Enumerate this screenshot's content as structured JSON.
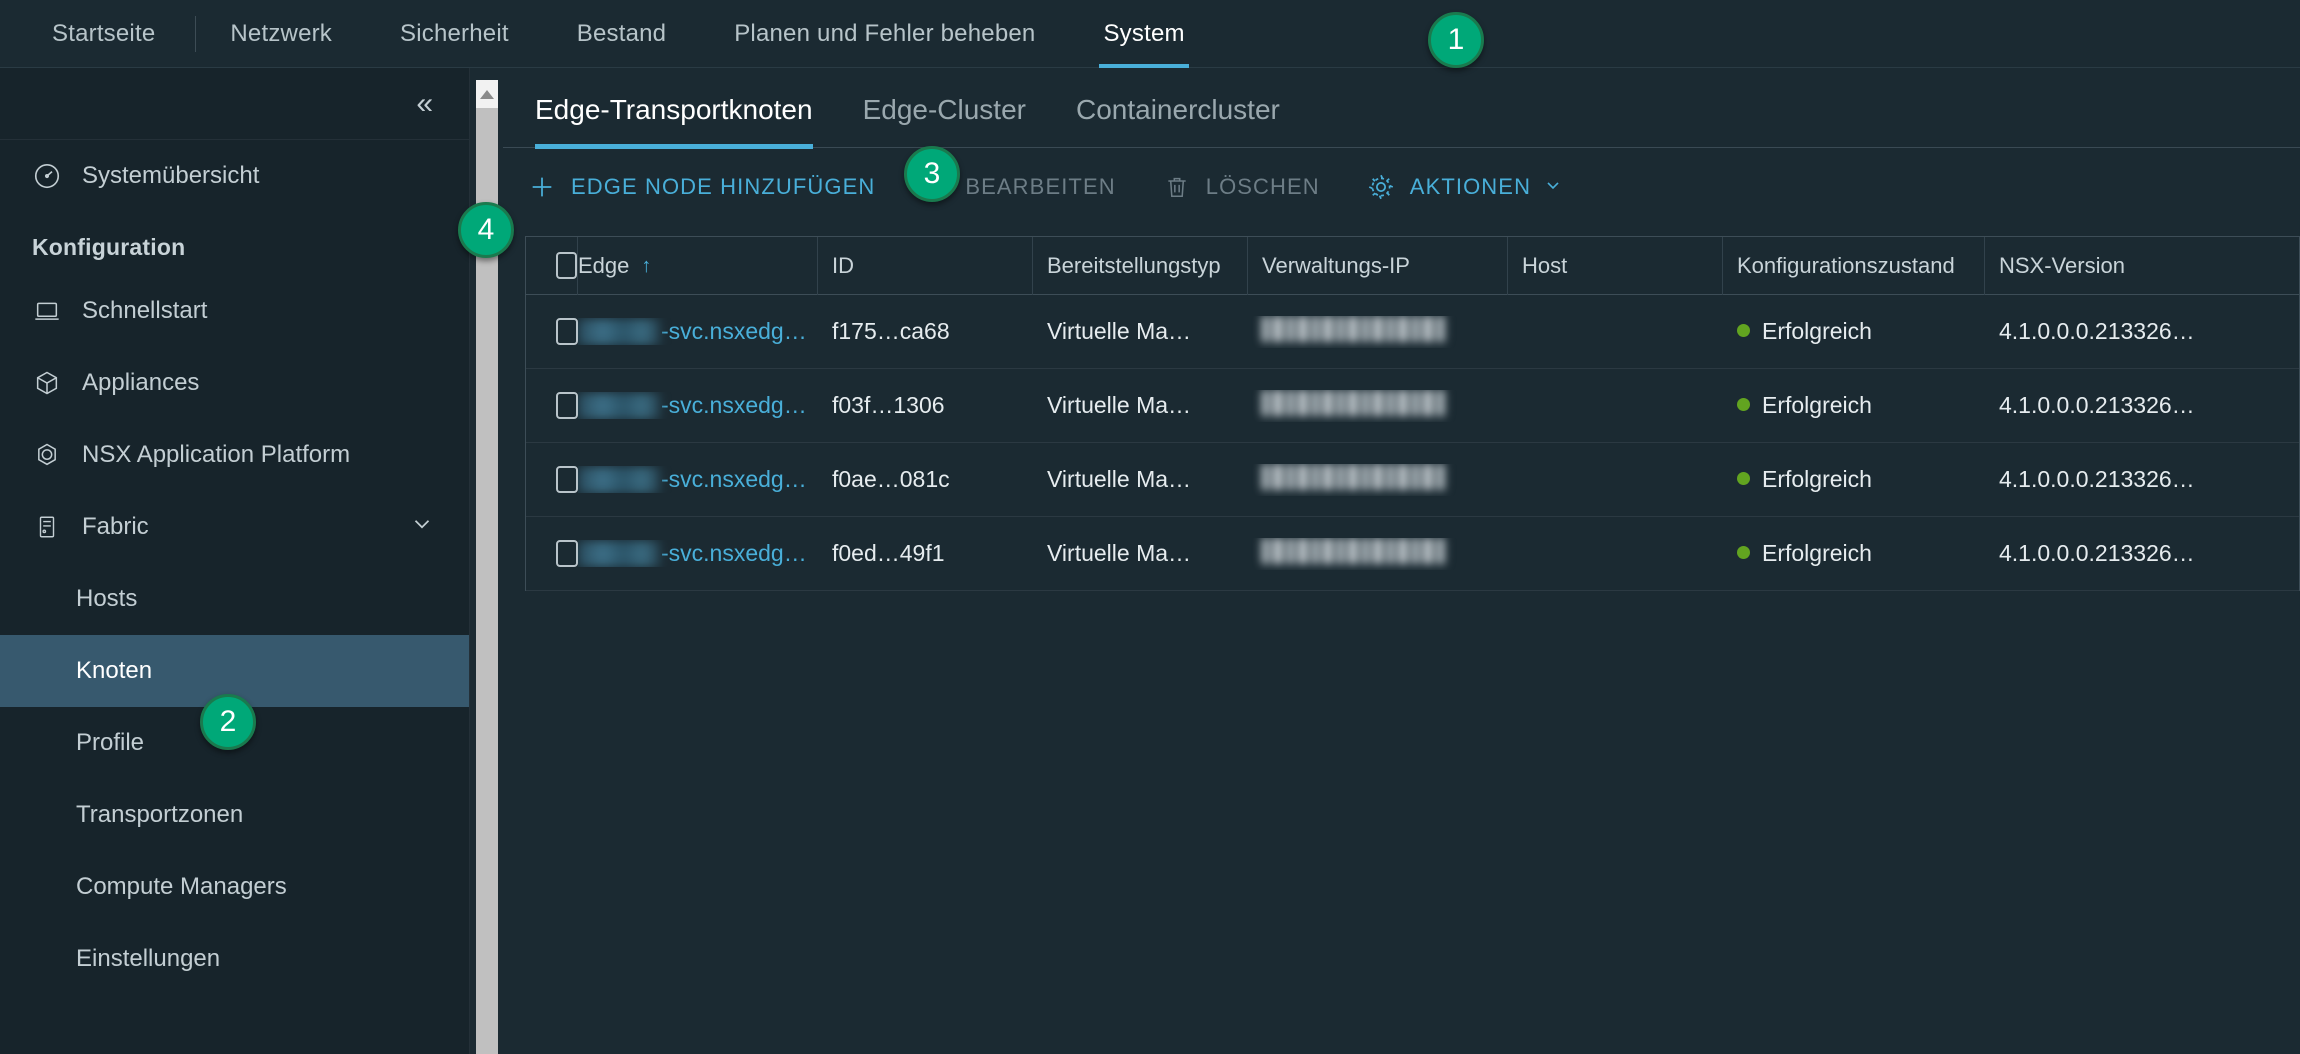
{
  "top_nav": {
    "items": [
      {
        "label": "Startseite",
        "active": false
      },
      {
        "label": "Netzwerk",
        "active": false
      },
      {
        "label": "Sicherheit",
        "active": false
      },
      {
        "label": "Bestand",
        "active": false
      },
      {
        "label": "Planen und Fehler beheben",
        "active": false
      },
      {
        "label": "System",
        "active": true
      }
    ]
  },
  "sidebar": {
    "collapse_icon": "«",
    "overview": {
      "label": "Systemübersicht",
      "icon": "gauge-icon"
    },
    "group_label": "Konfiguration",
    "items": [
      {
        "label": "Schnellstart",
        "icon": "laptop-icon"
      },
      {
        "label": "Appliances",
        "icon": "cube-icon"
      },
      {
        "label": "NSX Application Platform",
        "icon": "polygon-icon"
      },
      {
        "label": "Fabric",
        "icon": "rack-icon",
        "expandable": true,
        "chevron": "chevron-down-icon"
      },
      {
        "label": "Hosts",
        "sub": true
      },
      {
        "label": "Knoten",
        "sub": true,
        "selected": true
      },
      {
        "label": "Profile",
        "sub": true
      },
      {
        "label": "Transportzonen",
        "sub": true
      },
      {
        "label": "Compute Managers",
        "sub": true
      },
      {
        "label": "Einstellungen",
        "sub": true
      }
    ]
  },
  "subtabs": [
    {
      "label": "Edge-Transportknoten",
      "active": true
    },
    {
      "label": "Edge-Cluster",
      "active": false
    },
    {
      "label": "Containercluster",
      "active": false
    }
  ],
  "toolbar": {
    "add_label": "EDGE NODE HINZUFÜGEN",
    "add_icon": "plus-icon",
    "edit_label": "BEARBEITEN",
    "edit_icon": "pencil-icon",
    "delete_label": "LÖSCHEN",
    "delete_icon": "trash-icon",
    "actions_label": "AKTIONEN",
    "actions_icon": "gear-icon",
    "actions_caret": "chevron-down-icon"
  },
  "table": {
    "columns": [
      {
        "key": "edge",
        "label": "Edge",
        "sorted": "asc",
        "sort_glyph": "↑"
      },
      {
        "key": "id",
        "label": "ID"
      },
      {
        "key": "deployment",
        "label": "Bereitstellungstyp"
      },
      {
        "key": "mgmt_ip",
        "label": "Verwaltungs-IP"
      },
      {
        "key": "host",
        "label": "Host"
      },
      {
        "key": "config_state",
        "label": "Konfigurationszustand"
      },
      {
        "key": "nsx_version",
        "label": "NSX-Version"
      }
    ],
    "rows": [
      {
        "edge_prefix_redacted": true,
        "edge": "-svc.nsxedg…",
        "id": "f175…ca68",
        "deployment": "Virtuelle Ma…",
        "mgmt_ip_redacted": true,
        "mgmt_ip": "",
        "host": "",
        "config_state": "Erfolgreich",
        "config_state_color": "#62a420",
        "nsx_version": "4.1.0.0.0.213326…"
      },
      {
        "edge_prefix_redacted": true,
        "edge": "-svc.nsxedg…",
        "id": "f03f…1306",
        "deployment": "Virtuelle Ma…",
        "mgmt_ip_redacted": true,
        "mgmt_ip": "",
        "host": "",
        "config_state": "Erfolgreich",
        "config_state_color": "#62a420",
        "nsx_version": "4.1.0.0.0.213326…"
      },
      {
        "edge_prefix_redacted": true,
        "edge": "-svc.nsxedg…",
        "id": "f0ae…081c",
        "deployment": "Virtuelle Ma…",
        "mgmt_ip_redacted": true,
        "mgmt_ip": "",
        "host": "",
        "config_state": "Erfolgreich",
        "config_state_color": "#62a420",
        "nsx_version": "4.1.0.0.0.213326…"
      },
      {
        "edge_prefix_redacted": true,
        "edge": "-svc.nsxedg…",
        "id": "f0ed…49f1",
        "deployment": "Virtuelle Ma…",
        "mgmt_ip_redacted": true,
        "mgmt_ip": "",
        "host": "",
        "config_state": "Erfolgreich",
        "config_state_color": "#62a420",
        "nsx_version": "4.1.0.0.0.213326…"
      }
    ]
  },
  "callouts": [
    {
      "number": "1",
      "target": "top-nav-system"
    },
    {
      "number": "2",
      "target": "sidebar-item-knoten"
    },
    {
      "number": "3",
      "target": "subtab-edge-transportknoten"
    },
    {
      "number": "4",
      "target": "sidebar-scrollbar"
    }
  ],
  "colors": {
    "accent": "#49afd9",
    "callout": "#00a878",
    "status_ok": "#62a420",
    "background": "#1b2a32",
    "sidebar_bg": "#17242b",
    "selected_row": "#37596e"
  }
}
